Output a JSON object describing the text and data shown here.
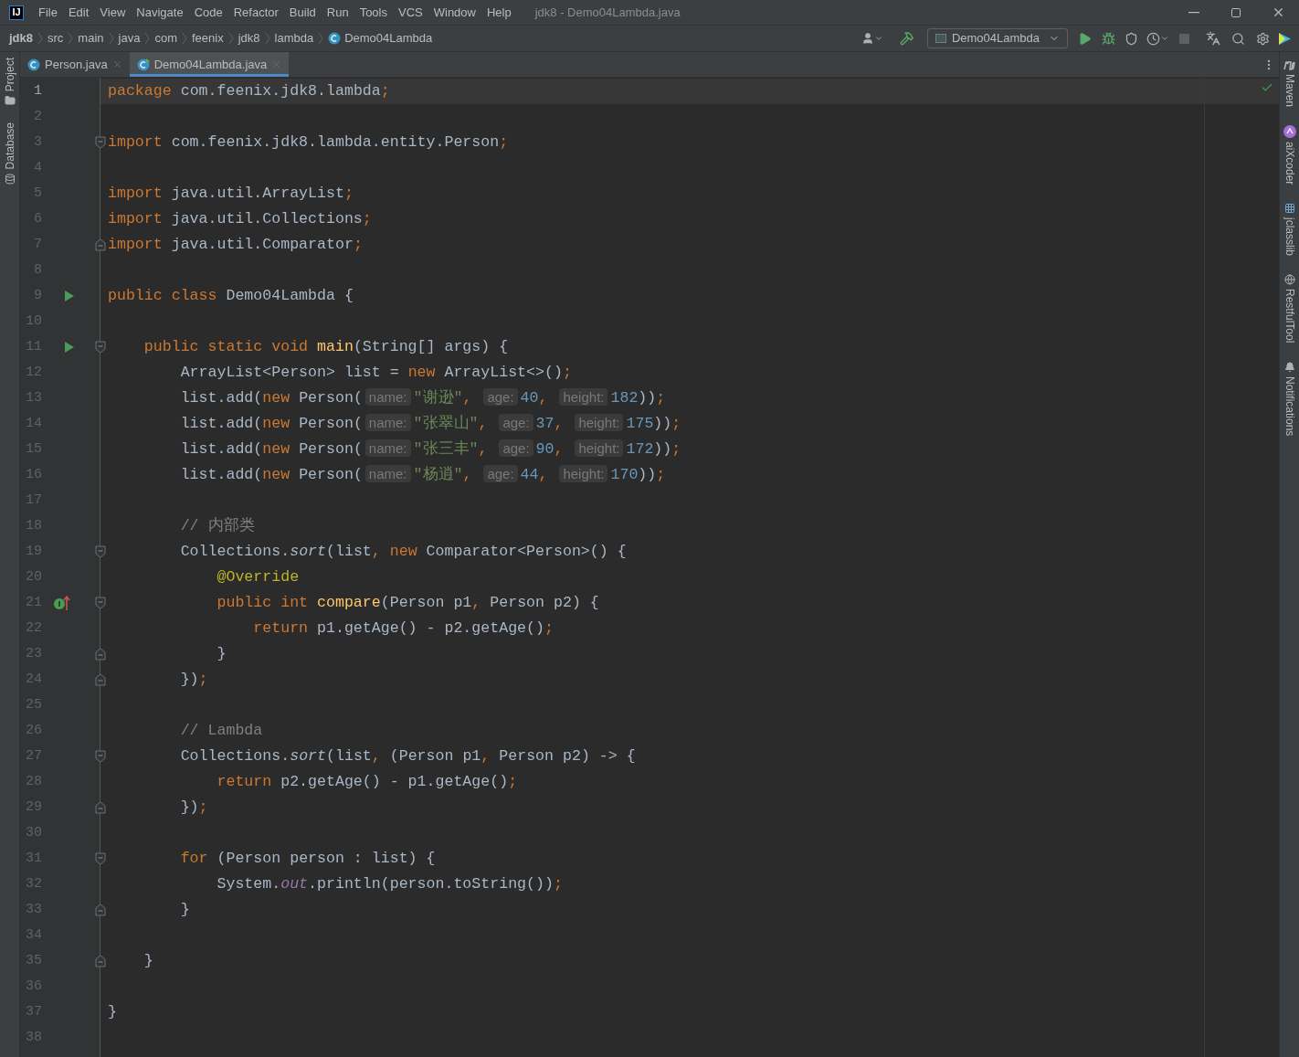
{
  "window": {
    "logo": "IJ",
    "title": "jdk8 - Demo04Lambda.java"
  },
  "menu": [
    "File",
    "Edit",
    "View",
    "Navigate",
    "Code",
    "Refactor",
    "Build",
    "Run",
    "Tools",
    "VCS",
    "Window",
    "Help"
  ],
  "breadcrumbs": [
    {
      "label": "jdk8",
      "kind": "project"
    },
    {
      "label": "src",
      "kind": "folder"
    },
    {
      "label": "main",
      "kind": "folder"
    },
    {
      "label": "java",
      "kind": "folder"
    },
    {
      "label": "com",
      "kind": "folder"
    },
    {
      "label": "feenix",
      "kind": "folder"
    },
    {
      "label": "jdk8",
      "kind": "folder"
    },
    {
      "label": "lambda",
      "kind": "folder"
    },
    {
      "label": "Demo04Lambda",
      "kind": "class"
    }
  ],
  "run_config": "Demo04Lambda",
  "tabs": [
    {
      "label": "Person.java",
      "selected": false,
      "kind": "class"
    },
    {
      "label": "Demo04Lambda.java",
      "selected": true,
      "kind": "runnable"
    }
  ],
  "left_tools": [
    {
      "label": "Project",
      "kind": "folder"
    },
    {
      "label": "Database",
      "kind": "database"
    }
  ],
  "right_tools": [
    {
      "label": "Maven",
      "kind": "maven"
    },
    {
      "label": "aiXcoder",
      "kind": "ai"
    },
    {
      "label": "jclasslib",
      "kind": "grid"
    },
    {
      "label": "RestfulTool",
      "kind": "globe"
    },
    {
      "label": "Notifications",
      "kind": "bell"
    }
  ],
  "editor": {
    "lines": [
      {
        "number": "1",
        "current": true,
        "tokens": [
          {
            "kind": "kw",
            "text": "package"
          },
          {
            "kind": "plain",
            "text": " com.feenix.jdk8.lambda"
          },
          {
            "kind": "punct",
            "text": ";"
          }
        ]
      },
      {
        "number": "2",
        "current": false
      },
      {
        "number": "3",
        "current": false,
        "fold": {
          "kind": "start"
        },
        "tokens": [
          {
            "kind": "kw",
            "text": "import"
          },
          {
            "kind": "plain",
            "text": " com.feenix.jdk8.lambda.entity.Person"
          },
          {
            "kind": "punct",
            "text": ";"
          }
        ]
      },
      {
        "number": "4",
        "current": false
      },
      {
        "number": "5",
        "current": false,
        "tokens": [
          {
            "kind": "kw",
            "text": "import"
          },
          {
            "kind": "plain",
            "text": " java.util.ArrayList"
          },
          {
            "kind": "punct",
            "text": ";"
          }
        ]
      },
      {
        "number": "6",
        "current": false,
        "tokens": [
          {
            "kind": "kw",
            "text": "import"
          },
          {
            "kind": "plain",
            "text": " java.util.Collections"
          },
          {
            "kind": "punct",
            "text": ";"
          }
        ]
      },
      {
        "number": "7",
        "current": false,
        "fold": {
          "kind": "end"
        },
        "tokens": [
          {
            "kind": "kw",
            "text": "import"
          },
          {
            "kind": "plain",
            "text": " java.util.Comparator"
          },
          {
            "kind": "punct",
            "text": ";"
          }
        ]
      },
      {
        "number": "8",
        "current": false
      },
      {
        "number": "9",
        "current": false,
        "gutter_icon": {
          "kind": "run"
        },
        "tokens": [
          {
            "kind": "kw",
            "text": "public class"
          },
          {
            "kind": "plain",
            "text": " Demo04Lambda {"
          }
        ]
      },
      {
        "number": "10",
        "current": false
      },
      {
        "number": "11",
        "current": false,
        "gutter_icon": {
          "kind": "run"
        },
        "fold": {
          "kind": "start"
        },
        "tokens": [
          {
            "kind": "kw",
            "text": "    public static void "
          },
          {
            "kind": "decl",
            "text": "main"
          },
          {
            "kind": "plain",
            "text": "(String[] args) {"
          }
        ]
      },
      {
        "number": "12",
        "current": false,
        "tokens": [
          {
            "kind": "plain",
            "text": "        ArrayList<Person> list = "
          },
          {
            "kind": "kw",
            "text": "new"
          },
          {
            "kind": "plain",
            "text": " ArrayList<>()"
          },
          {
            "kind": "punct",
            "text": ";"
          }
        ]
      },
      {
        "number": "13",
        "current": false,
        "tokens": [
          {
            "kind": "plain",
            "text": "        list.add("
          },
          {
            "kind": "kw",
            "text": "new"
          },
          {
            "kind": "plain",
            "text": " Person("
          },
          {
            "kind": "hint",
            "text": "name:"
          },
          {
            "kind": "str",
            "text": "\"谢逊\""
          },
          {
            "kind": "punct",
            "text": ", "
          },
          {
            "kind": "hint",
            "text": "age:"
          },
          {
            "kind": "num",
            "text": "40"
          },
          {
            "kind": "punct",
            "text": ", "
          },
          {
            "kind": "hint",
            "text": "height:"
          },
          {
            "kind": "num",
            "text": "182"
          },
          {
            "kind": "plain",
            "text": "))"
          },
          {
            "kind": "punct",
            "text": ";"
          }
        ]
      },
      {
        "number": "14",
        "current": false,
        "tokens": [
          {
            "kind": "plain",
            "text": "        list.add("
          },
          {
            "kind": "kw",
            "text": "new"
          },
          {
            "kind": "plain",
            "text": " Person("
          },
          {
            "kind": "hint",
            "text": "name:"
          },
          {
            "kind": "str",
            "text": "\"张翠山\""
          },
          {
            "kind": "punct",
            "text": ", "
          },
          {
            "kind": "hint",
            "text": "age:"
          },
          {
            "kind": "num",
            "text": "37"
          },
          {
            "kind": "punct",
            "text": ", "
          },
          {
            "kind": "hint",
            "text": "height:"
          },
          {
            "kind": "num",
            "text": "175"
          },
          {
            "kind": "plain",
            "text": "))"
          },
          {
            "kind": "punct",
            "text": ";"
          }
        ]
      },
      {
        "number": "15",
        "current": false,
        "tokens": [
          {
            "kind": "plain",
            "text": "        list.add("
          },
          {
            "kind": "kw",
            "text": "new"
          },
          {
            "kind": "plain",
            "text": " Person("
          },
          {
            "kind": "hint",
            "text": "name:"
          },
          {
            "kind": "str",
            "text": "\"张三丰\""
          },
          {
            "kind": "punct",
            "text": ", "
          },
          {
            "kind": "hint",
            "text": "age:"
          },
          {
            "kind": "num",
            "text": "90"
          },
          {
            "kind": "punct",
            "text": ", "
          },
          {
            "kind": "hint",
            "text": "height:"
          },
          {
            "kind": "num",
            "text": "172"
          },
          {
            "kind": "plain",
            "text": "))"
          },
          {
            "kind": "punct",
            "text": ";"
          }
        ]
      },
      {
        "number": "16",
        "current": false,
        "tokens": [
          {
            "kind": "plain",
            "text": "        list.add("
          },
          {
            "kind": "kw",
            "text": "new"
          },
          {
            "kind": "plain",
            "text": " Person("
          },
          {
            "kind": "hint",
            "text": "name:"
          },
          {
            "kind": "str",
            "text": "\"杨逍\""
          },
          {
            "kind": "punct",
            "text": ", "
          },
          {
            "kind": "hint",
            "text": "age:"
          },
          {
            "kind": "num",
            "text": "44"
          },
          {
            "kind": "punct",
            "text": ", "
          },
          {
            "kind": "hint",
            "text": "height:"
          },
          {
            "kind": "num",
            "text": "170"
          },
          {
            "kind": "plain",
            "text": "))"
          },
          {
            "kind": "punct",
            "text": ";"
          }
        ]
      },
      {
        "number": "17",
        "current": false
      },
      {
        "number": "18",
        "current": false,
        "tokens": [
          {
            "kind": "comment",
            "text": "        // 内部类"
          }
        ]
      },
      {
        "number": "19",
        "current": false,
        "fold": {
          "kind": "start"
        },
        "tokens": [
          {
            "kind": "plain",
            "text": "        Collections."
          },
          {
            "kind": "italic",
            "text": "sort"
          },
          {
            "kind": "plain",
            "text": "(list"
          },
          {
            "kind": "punct",
            "text": ", "
          },
          {
            "kind": "kw",
            "text": "new"
          },
          {
            "kind": "plain",
            "text": " Comparator<Person>() {"
          }
        ]
      },
      {
        "number": "20",
        "current": false,
        "tokens": [
          {
            "kind": "annot",
            "text": "            @Override"
          }
        ]
      },
      {
        "number": "21",
        "current": false,
        "gutter_icon": {
          "kind": "implements"
        },
        "fold": {
          "kind": "start"
        },
        "tokens": [
          {
            "kind": "kw",
            "text": "            public int "
          },
          {
            "kind": "decl",
            "text": "compare"
          },
          {
            "kind": "plain",
            "text": "(Person p1"
          },
          {
            "kind": "punct",
            "text": ","
          },
          {
            "kind": "plain",
            "text": " Person p2) {"
          }
        ]
      },
      {
        "number": "22",
        "current": false,
        "tokens": [
          {
            "kind": "kw",
            "text": "                return"
          },
          {
            "kind": "plain",
            "text": " p1.getAge() - p2.getAge()"
          },
          {
            "kind": "punct",
            "text": ";"
          }
        ]
      },
      {
        "number": "23",
        "current": false,
        "fold": {
          "kind": "end"
        },
        "tokens": [
          {
            "kind": "plain",
            "text": "            }"
          }
        ]
      },
      {
        "number": "24",
        "current": false,
        "fold": {
          "kind": "end"
        },
        "tokens": [
          {
            "kind": "plain",
            "text": "        })"
          },
          {
            "kind": "punct",
            "text": ";"
          }
        ]
      },
      {
        "number": "25",
        "current": false
      },
      {
        "number": "26",
        "current": false,
        "tokens": [
          {
            "kind": "comment",
            "text": "        // Lambda"
          }
        ]
      },
      {
        "number": "27",
        "current": false,
        "fold": {
          "kind": "start"
        },
        "tokens": [
          {
            "kind": "plain",
            "text": "        Collections."
          },
          {
            "kind": "italic",
            "text": "sort"
          },
          {
            "kind": "plain",
            "text": "(list"
          },
          {
            "kind": "punct",
            "text": ","
          },
          {
            "kind": "plain",
            "text": " (Person p1"
          },
          {
            "kind": "punct",
            "text": ","
          },
          {
            "kind": "plain",
            "text": " Person p2) -> {"
          }
        ]
      },
      {
        "number": "28",
        "current": false,
        "tokens": [
          {
            "kind": "kw",
            "text": "            return"
          },
          {
            "kind": "plain",
            "text": " p2.getAge() - p1.getAge()"
          },
          {
            "kind": "punct",
            "text": ";"
          }
        ]
      },
      {
        "number": "29",
        "current": false,
        "fold": {
          "kind": "end"
        },
        "tokens": [
          {
            "kind": "plain",
            "text": "        })"
          },
          {
            "kind": "punct",
            "text": ";"
          }
        ]
      },
      {
        "number": "30",
        "current": false
      },
      {
        "number": "31",
        "current": false,
        "fold": {
          "kind": "start"
        },
        "tokens": [
          {
            "kind": "kw",
            "text": "        for"
          },
          {
            "kind": "plain",
            "text": " (Person person : list) {"
          }
        ]
      },
      {
        "number": "32",
        "current": false,
        "tokens": [
          {
            "kind": "plain",
            "text": "            System."
          },
          {
            "kind": "field",
            "text": "out"
          },
          {
            "kind": "plain",
            "text": ".println(person.toString())"
          },
          {
            "kind": "punct",
            "text": ";"
          }
        ]
      },
      {
        "number": "33",
        "current": false,
        "fold": {
          "kind": "end"
        },
        "tokens": [
          {
            "kind": "plain",
            "text": "        }"
          }
        ]
      },
      {
        "number": "34",
        "current": false
      },
      {
        "number": "35",
        "current": false,
        "fold": {
          "kind": "end"
        },
        "tokens": [
          {
            "kind": "plain",
            "text": "    }"
          }
        ]
      },
      {
        "number": "36",
        "current": false
      },
      {
        "number": "37",
        "current": false,
        "tokens": [
          {
            "kind": "plain",
            "text": "}"
          }
        ]
      },
      {
        "number": "38",
        "current": false
      }
    ]
  }
}
